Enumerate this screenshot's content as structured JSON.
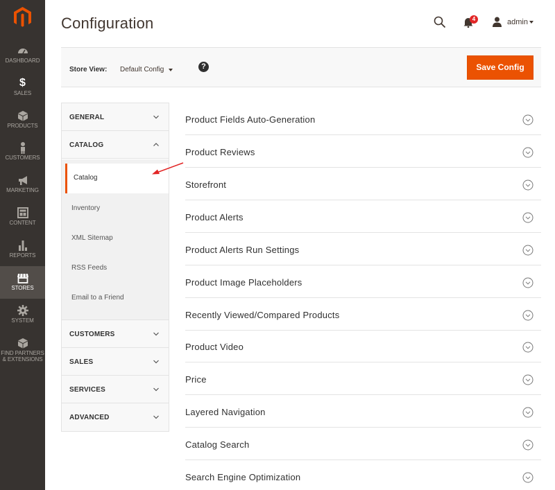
{
  "nav": {
    "items": [
      {
        "label": "DASHBOARD",
        "icon": "dashboard-icon"
      },
      {
        "label": "SALES",
        "icon": "dollar-icon"
      },
      {
        "label": "PRODUCTS",
        "icon": "cube-icon"
      },
      {
        "label": "CUSTOMERS",
        "icon": "person-icon"
      },
      {
        "label": "MARKETING",
        "icon": "megaphone-icon"
      },
      {
        "label": "CONTENT",
        "icon": "layout-icon"
      },
      {
        "label": "REPORTS",
        "icon": "bar-chart-icon"
      },
      {
        "label": "STORES",
        "icon": "storefront-icon"
      },
      {
        "label": "SYSTEM",
        "icon": "gear-icon"
      },
      {
        "label": "FIND PARTNERS",
        "label2": "& EXTENSIONS",
        "icon": "box-icon"
      }
    ],
    "active": "STORES"
  },
  "header": {
    "title": "Configuration",
    "notifications_count": "4",
    "username": "admin"
  },
  "store_bar": {
    "label": "Store View:",
    "value": "Default Config",
    "help": "?",
    "save_label": "Save Config"
  },
  "tabs": {
    "general": "GENERAL",
    "catalog": "CATALOG",
    "catalog_items": [
      "Catalog",
      "Inventory",
      "XML Sitemap",
      "RSS Feeds",
      "Email to a Friend"
    ],
    "customers": "CUSTOMERS",
    "sales": "SALES",
    "services": "SERVICES",
    "advanced": "ADVANCED"
  },
  "sections": [
    "Product Fields Auto-Generation",
    "Product Reviews",
    "Storefront",
    "Product Alerts",
    "Product Alerts Run Settings",
    "Product Image Placeholders",
    "Recently Viewed/Compared Products",
    "Product Video",
    "Price",
    "Layered Navigation",
    "Catalog Search",
    "Search Engine Optimization"
  ],
  "colors": {
    "accent": "#eb5202",
    "nav_bg": "#373330",
    "annotation": "#e22626"
  }
}
